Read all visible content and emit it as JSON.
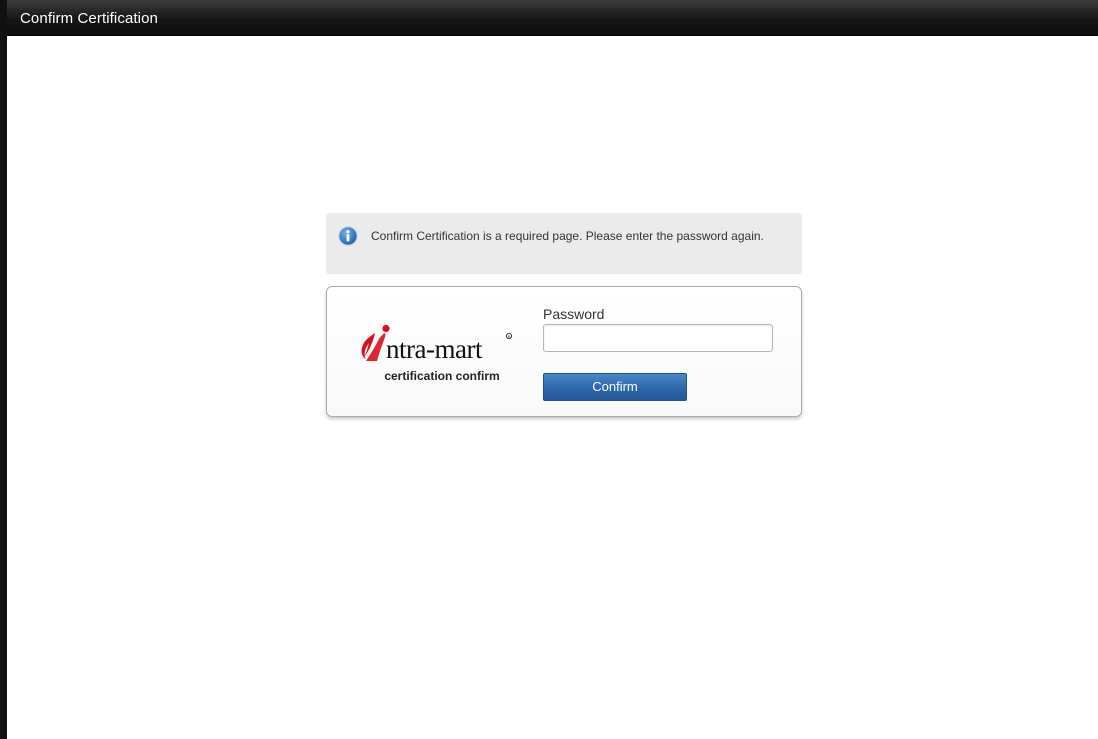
{
  "window": {
    "title": "Confirm Certification"
  },
  "notice": {
    "icon": "info-icon",
    "message": "Confirm Certification is a required page. Please enter the password again."
  },
  "logo": {
    "brand": "intra-mart",
    "caption": "certification confirm"
  },
  "form": {
    "password_label": "Password",
    "password_value": "",
    "confirm_label": "Confirm"
  },
  "colors": {
    "titlebar": "#161616",
    "notice_bg": "#ebebeb",
    "button": "#2e68aa",
    "logo_red": "#d9101c",
    "info_blue": "#2f6fc0"
  }
}
